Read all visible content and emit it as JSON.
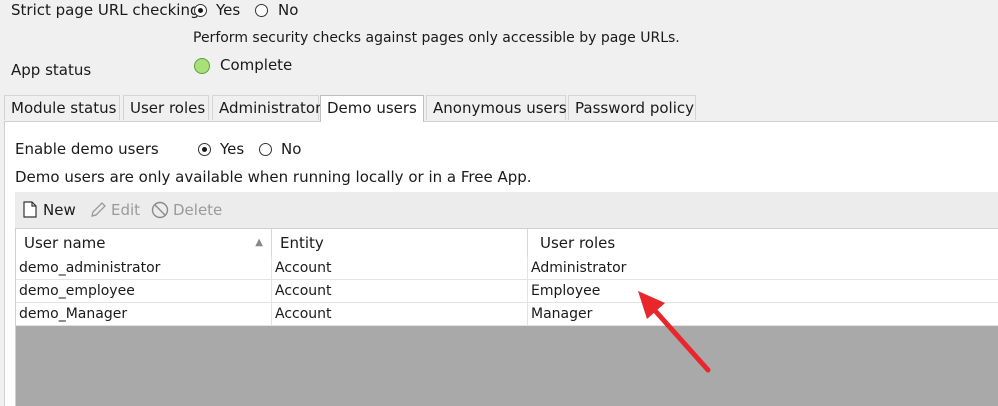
{
  "settings": {
    "strict_label": "Strict page URL checking",
    "strict_yes": "Yes",
    "strict_no": "No",
    "strict_help": "Perform security checks against pages only accessible by page URLs.",
    "app_status_label": "App status",
    "app_status_value": "Complete"
  },
  "tabs": [
    "Module status",
    "User roles",
    "Administrator",
    "Demo users",
    "Anonymous users",
    "Password policy"
  ],
  "demo_users": {
    "enable_label": "Enable demo users",
    "enable_yes": "Yes",
    "enable_no": "No",
    "info": "Demo users are only available when running locally or in a Free App.",
    "toolbar": {
      "new": "New",
      "edit": "Edit",
      "delete": "Delete"
    },
    "columns": [
      "User name",
      "Entity",
      "User roles"
    ],
    "rows": [
      [
        "demo_administrator",
        "Account",
        "Administrator"
      ],
      [
        "demo_employee",
        "Account",
        "Employee"
      ],
      [
        "demo_Manager",
        "Account",
        "Manager"
      ]
    ]
  },
  "colors": {
    "status_ok": "#a8e07a",
    "annotation_arrow": "#e8262b",
    "empty_grid": "#a9a9a9"
  },
  "icons": {
    "new": "new-document-icon",
    "edit": "pencil-icon",
    "delete": "prohibited-icon",
    "sort": "sort-ascending-icon"
  }
}
